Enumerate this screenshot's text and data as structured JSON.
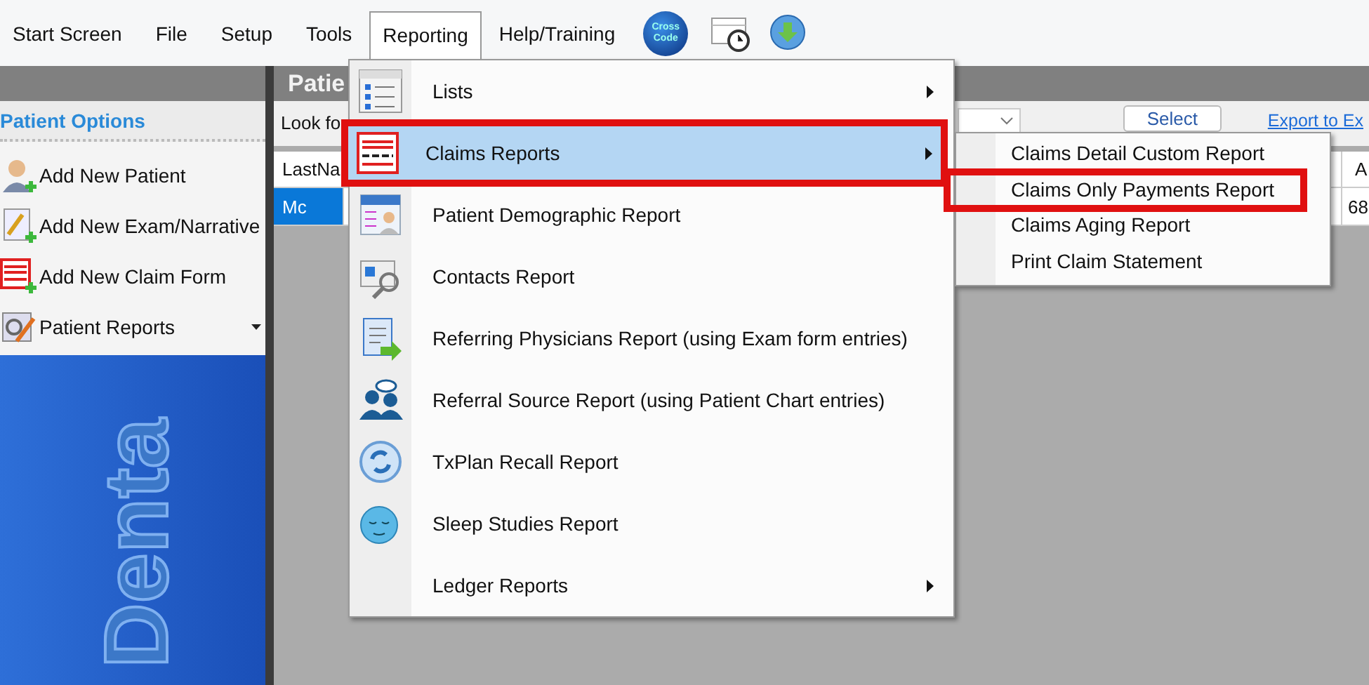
{
  "menubar": {
    "items": [
      {
        "label": "Start Screen",
        "selected": false
      },
      {
        "label": "File",
        "selected": false
      },
      {
        "label": "Setup",
        "selected": false
      },
      {
        "label": "Tools",
        "selected": false
      },
      {
        "label": "Reporting",
        "selected": true
      },
      {
        "label": "Help/Training",
        "selected": false
      }
    ],
    "crosscode_label": "Cross Code"
  },
  "sidebar": {
    "title": "Patient Options",
    "items": [
      {
        "label": "Add New Patient",
        "kind": "action"
      },
      {
        "label": "Add New Exam/Narrative",
        "kind": "action"
      },
      {
        "label": "Add New Claim Form",
        "kind": "action"
      },
      {
        "label": "Patient Reports",
        "kind": "dropdown"
      }
    ],
    "logo_text": "Denta"
  },
  "main": {
    "title": "Patie",
    "search_label": "Look fo",
    "select_button": "Select",
    "export_link": "Export to Ex",
    "table": {
      "columns": [
        "LastNa",
        "A"
      ],
      "rows": [
        {
          "cells": [
            "Mc",
            "68"
          ],
          "selected": true
        }
      ]
    }
  },
  "menu": {
    "items": [
      {
        "label": "Lists",
        "submenu": true,
        "selected": false,
        "highlighted": false
      },
      {
        "label": "Claims Reports",
        "submenu": true,
        "selected": true,
        "highlighted": true
      },
      {
        "label": "Patient Demographic Report",
        "submenu": false,
        "selected": false,
        "highlighted": false
      },
      {
        "label": "Contacts Report",
        "submenu": false,
        "selected": false,
        "highlighted": false
      },
      {
        "label": "Referring Physicians Report (using Exam form entries)",
        "submenu": false,
        "selected": false,
        "highlighted": false
      },
      {
        "label": "Referral Source Report (using Patient Chart entries)",
        "submenu": false,
        "selected": false,
        "highlighted": false
      },
      {
        "label": "TxPlan Recall Report",
        "submenu": false,
        "selected": false,
        "highlighted": false
      },
      {
        "label": "Sleep Studies Report",
        "submenu": false,
        "selected": false,
        "highlighted": false
      },
      {
        "label": "Ledger Reports",
        "submenu": true,
        "selected": false,
        "highlighted": false
      }
    ],
    "submenu": {
      "items": [
        {
          "label": "Claims Detail Custom Report",
          "highlighted": false
        },
        {
          "label": "Claims Only Payments Report",
          "highlighted": true
        },
        {
          "label": "Claims Aging Report",
          "highlighted": false
        },
        {
          "label": "Print Claim Statement",
          "highlighted": false
        }
      ]
    }
  }
}
